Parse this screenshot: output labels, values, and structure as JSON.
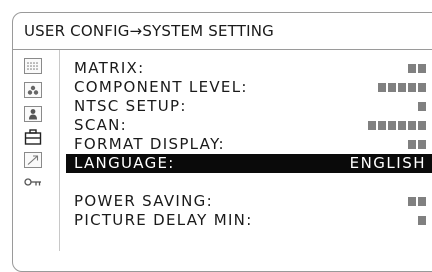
{
  "header": {
    "title": "USER CONFIG→SYSTEM SETTING"
  },
  "side_icons": [
    {
      "name": "matrix-grid-icon"
    },
    {
      "name": "color-dots-icon"
    },
    {
      "name": "person-icon"
    },
    {
      "name": "toolbox-icon"
    },
    {
      "name": "arrow-icon"
    },
    {
      "name": "key-icon"
    }
  ],
  "menu": {
    "items": [
      {
        "label": "MATRIX:",
        "blocks": 2
      },
      {
        "label": "COMPONENT LEVEL:",
        "blocks": 5
      },
      {
        "label": "NTSC SETUP:",
        "blocks": 1
      },
      {
        "label": "SCAN:",
        "blocks": 6
      },
      {
        "label": "FORMAT DISPLAY:",
        "blocks": 2
      },
      {
        "label": "LANGUAGE:",
        "value": "ENGLISH",
        "selected": true
      },
      {
        "label": "POWER SAVING:",
        "blocks": 2
      },
      {
        "label": "PICTURE DELAY MIN:",
        "blocks": 1
      }
    ]
  },
  "colors": {
    "frame": "#9a9a9a",
    "selection_bg": "#0a0a0a",
    "selection_fg": "#ffffff",
    "value_block": "#808080"
  }
}
